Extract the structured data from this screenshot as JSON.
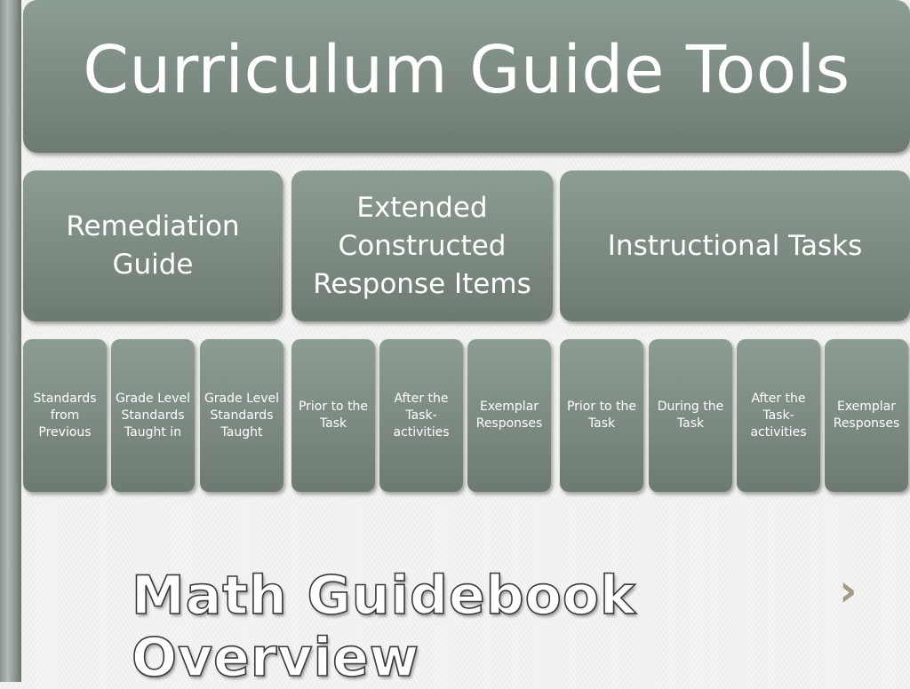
{
  "title": "Curriculum Guide Tools",
  "categories": [
    {
      "label": "Remediation Guide"
    },
    {
      "label": "Extended Constructed Response Items"
    },
    {
      "label": "Instructional Tasks"
    }
  ],
  "subitems": [
    {
      "label": "Standards from Previous"
    },
    {
      "label": "Grade Level Standards Taught in"
    },
    {
      "label": "Grade Level Standards Taught"
    },
    {
      "label": "Prior to the Task"
    },
    {
      "label": "After the Task-activities"
    },
    {
      "label": "Exemplar Responses"
    },
    {
      "label": "Prior to the Task"
    },
    {
      "label": "During the Task"
    },
    {
      "label": "After the Task-activities"
    },
    {
      "label": "Exemplar Responses"
    }
  ],
  "footer": {
    "title": "Math Guidebook Overview",
    "chevron": "›"
  },
  "colors": {
    "box": "#7c8a81",
    "text": "#ffffff",
    "chevron": "#a39a88"
  }
}
